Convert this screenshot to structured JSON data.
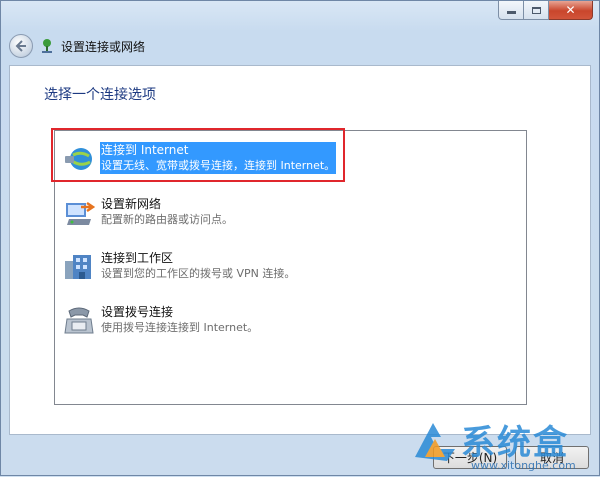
{
  "window": {
    "title": "设置连接或网络",
    "caption_buttons": {
      "minimize_icon": "minimize-icon",
      "maximize_icon": "maximize-icon",
      "close_icon": "close-icon"
    }
  },
  "nav": {
    "back_icon": "back-arrow-icon",
    "title_icon": "network-setup-icon"
  },
  "main": {
    "heading": "选择一个连接选项",
    "options": [
      {
        "title": "连接到 Internet",
        "description": "设置无线、宽带或拨号连接，连接到 Internet。",
        "icon": "globe-network-icon",
        "selected": true
      },
      {
        "title": "设置新网络",
        "description": "配置新的路由器或访问点。",
        "icon": "router-icon",
        "selected": false
      },
      {
        "title": "连接到工作区",
        "description": "设置到您的工作区的拨号或 VPN 连接。",
        "icon": "workplace-icon",
        "selected": false
      },
      {
        "title": "设置拨号连接",
        "description": "使用拨号连接连接到 Internet。",
        "icon": "telephone-modem-icon",
        "selected": false
      }
    ]
  },
  "footer": {
    "next_label": "下一步(N)",
    "cancel_label": "取消"
  },
  "watermark": {
    "text": "系统盒",
    "url": "www.xitonghe.com"
  },
  "colors": {
    "selection": "#3399ff",
    "heading": "#1d3a82",
    "highlight_box": "#e0262c"
  }
}
